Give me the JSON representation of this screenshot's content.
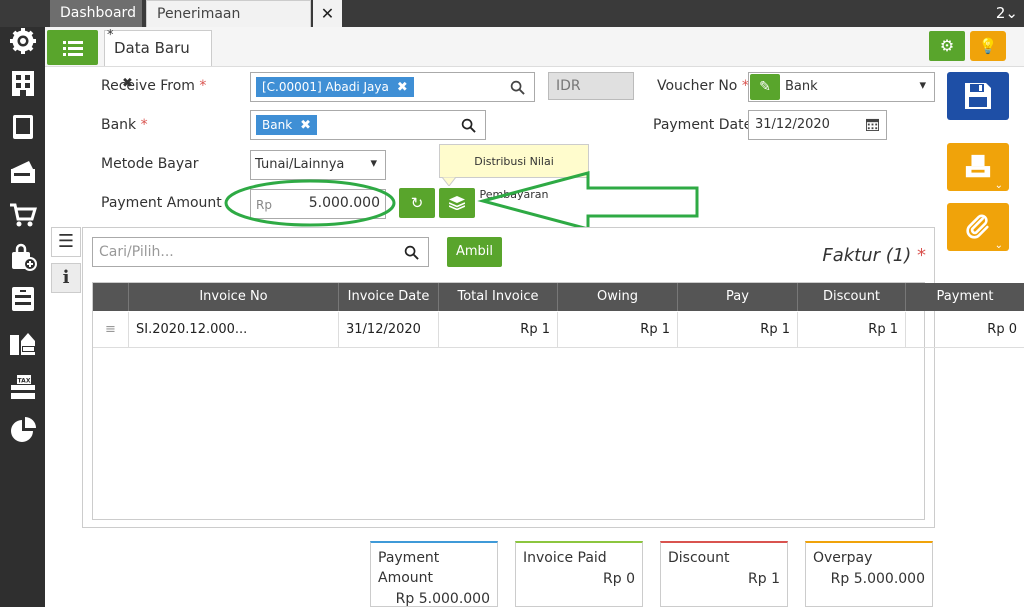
{
  "tabs": {
    "dashboard": "Dashboard",
    "penerimaan": "Penerimaan Penjualan",
    "close": "✕",
    "count": "2⌄"
  },
  "subtab": {
    "title": "Data Baru",
    "modified_marker": "*",
    "close": "✖"
  },
  "form": {
    "receive_from_label": "Receive From",
    "receive_from_chip": "[C.00001] Abadi Jaya",
    "currency": "IDR",
    "voucher_label": "Voucher No",
    "voucher_value": "Bank",
    "bank_label": "Bank",
    "bank_chip": "Bank",
    "payment_date_label": "Payment Date",
    "payment_date_value": "31/12/2020",
    "metode_label": "Metode Bayar",
    "metode_value": "Tunai/Lainnya",
    "amount_label": "Payment Amount",
    "amount_prefix": "Rp",
    "amount_value": "5.000.000",
    "required_mark": "*"
  },
  "tooltip": "Distribusi Nilai Pembayaran",
  "invoice_panel": {
    "search_placeholder": "Cari/Pilih...",
    "ambil_label": "Ambil",
    "title": "Faktur (1)",
    "required_mark": "*",
    "columns": [
      "Invoice No",
      "Invoice Date",
      "Total Invoice",
      "Owing",
      "Pay",
      "Discount",
      "Payment"
    ],
    "rows": [
      {
        "handle": "≡",
        "invoice_no": "SI.2020.12.000...",
        "invoice_date": "31/12/2020",
        "total": "Rp 1",
        "owing": "Rp 1",
        "pay": "Rp 1",
        "discount": "Rp 1",
        "payment": "Rp 0"
      }
    ]
  },
  "summary": {
    "payment_amount_label_1": "Payment",
    "payment_amount_label_2": "Amount",
    "payment_amount_value": "Rp 5.000.000",
    "invoice_paid_label": "Invoice Paid",
    "invoice_paid_value": "Rp 0",
    "discount_label": "Discount",
    "discount_value": "Rp 1",
    "overpay_label": "Overpay",
    "overpay_value": "Rp 5.000.000"
  },
  "colors": {
    "green": "#59a52c",
    "orange": "#f0a30a",
    "blue": "#1e4fa6",
    "chip": "#3f8fd5",
    "annotation": "#2eaa44"
  }
}
